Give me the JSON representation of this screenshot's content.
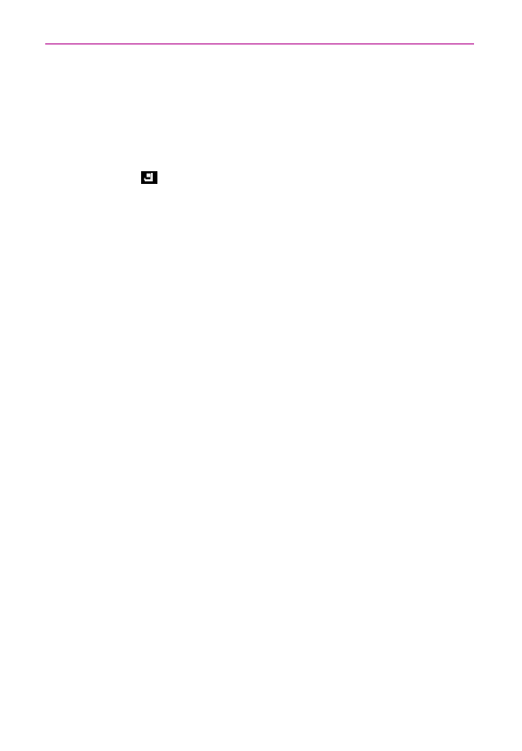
{
  "page": {
    "header_rule_color": "#b0008a",
    "icon": "recent-apps-icon",
    "icon_color": "#000000"
  }
}
